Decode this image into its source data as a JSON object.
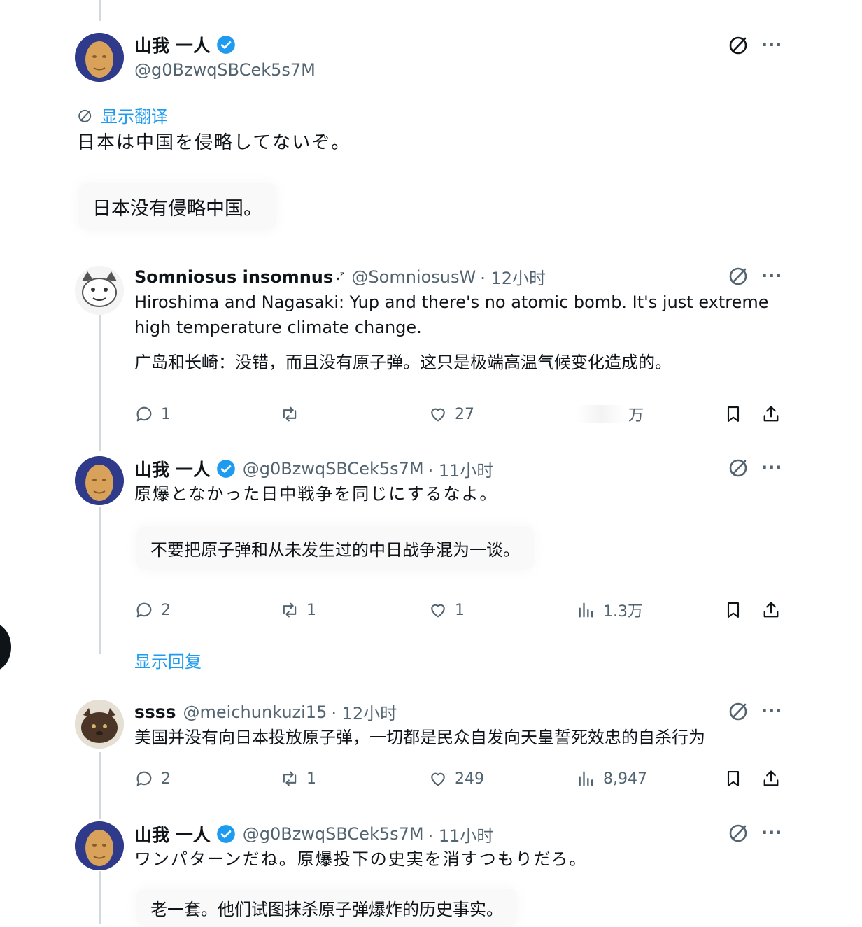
{
  "post": {
    "user_name": "山我 一人",
    "handle": "@g0BzwqSBCek5s7M",
    "show_translation": "显示翻译",
    "text": "日本は中国を侵略してないぞ。",
    "translation": "日本没有侵略中国。"
  },
  "replies": [
    {
      "user_name": "Somniosus insomnus",
      "name_suffix": "𝆺ᶻ",
      "handle": "@SomniosusW",
      "time": "· 12小时",
      "text": "Hiroshima and Nagasaki: Yup and there's no atomic bomb. It's just extreme high temperature climate change.",
      "translation": "广岛和长崎：没错，而且没有原子弹。这只是极端高温气候变化造成的。",
      "stats": {
        "replies": "1",
        "retweets": "",
        "likes": "27",
        "views": "万"
      }
    },
    {
      "user_name": "山我 一人",
      "handle": "@g0BzwqSBCek5s7M",
      "time": "· 11小时",
      "text": "原爆となかった日中戦争を同じにするなよ。",
      "translation": "不要把原子弹和从未发生过的中日战争混为一谈。",
      "stats": {
        "replies": "2",
        "retweets": "1",
        "likes": "1",
        "views": "1.3万"
      },
      "show_replies": "显示回复"
    },
    {
      "user_name": "ssss",
      "handle": "@meichunkuzi15",
      "time": "· 12小时",
      "text": "美国并没有向日本投放原子弹，一切都是民众自发向天皇誓死效忠的自杀行为",
      "stats": {
        "replies": "2",
        "retweets": "1",
        "likes": "249",
        "views": "8,947"
      }
    },
    {
      "user_name": "山我 一人",
      "handle": "@g0BzwqSBCek5s7M",
      "time": "· 11小时",
      "text": "ワンパターンだね。原爆投下の史実を消すつもりだろ。",
      "translation": "老一套。他们试图抹杀原子弹爆炸的历史事实。"
    }
  ],
  "more_label": "···",
  "colors": {
    "accent": "#1d9bf0",
    "muted": "#536471",
    "text": "#0f1419",
    "thread": "#cfd9de"
  }
}
